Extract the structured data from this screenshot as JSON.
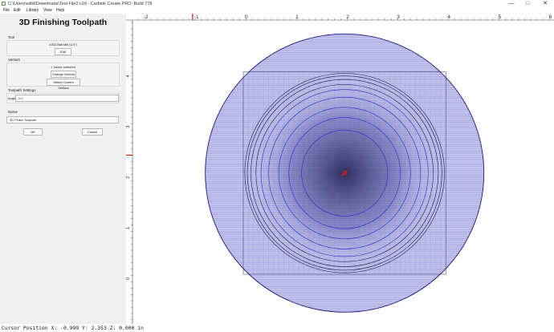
{
  "window": {
    "title": "C:\\Users\\willd\\Downloads\\Test File2.c2d - Carbide Create PRO: Build 778",
    "minimize_glyph": "—",
    "maximize_glyph": "□",
    "close_glyph": "✕"
  },
  "menu": [
    "File",
    "Edit",
    "Library",
    "View",
    "Help"
  ],
  "panel": {
    "title": "3D Finishing Toolpath",
    "tool": {
      "section_label": "Tool",
      "tool_name": "#202 Ball Mill (1/4\")",
      "edit_label": "Edit"
    },
    "vectors": {
      "section_label": "Vectors",
      "selected_text": "1 Vector selected",
      "change_label": "Change Vectors",
      "select_current_label": "Select Current Vectors"
    },
    "settings": {
      "section_label": "Toolpath Settings",
      "angle_label": "Angle",
      "angle_value": "0.0"
    },
    "name": {
      "section_label": "Name",
      "value": "3D Finish Toolpath"
    },
    "ok_label": "OK",
    "cancel_label": "Cancel"
  },
  "rulers": {
    "x_ticks": [
      "-2",
      "-1",
      "0",
      "1",
      "2",
      "3",
      "4",
      "5",
      "6"
    ],
    "y_ticks": [
      "4",
      "3",
      "2",
      "1",
      "0"
    ],
    "cursor_x": -1,
    "cursor_y": 2.353
  },
  "design": {
    "circle_center": [
      2,
      2
    ],
    "circle_radius": 2.75,
    "rect_x_range": [
      0,
      4
    ],
    "rect_y_range": [
      0,
      4
    ],
    "ring_radii": [
      0.85,
      1.1,
      1.3,
      1.5,
      1.65,
      1.75,
      1.85,
      1.92,
      1.97
    ],
    "colors": {
      "outline": "#1a1a80",
      "fill": "#c8c8ee",
      "hatch": "#5555c0",
      "ring": "#2a2ad0",
      "ring_dark": "#17174a",
      "cursor": "#cc0000",
      "origin_marker": "#e02020"
    }
  },
  "status": {
    "text": "Cursor Position X: -0.999 Y: 2.353 Z: 0.000 in"
  }
}
